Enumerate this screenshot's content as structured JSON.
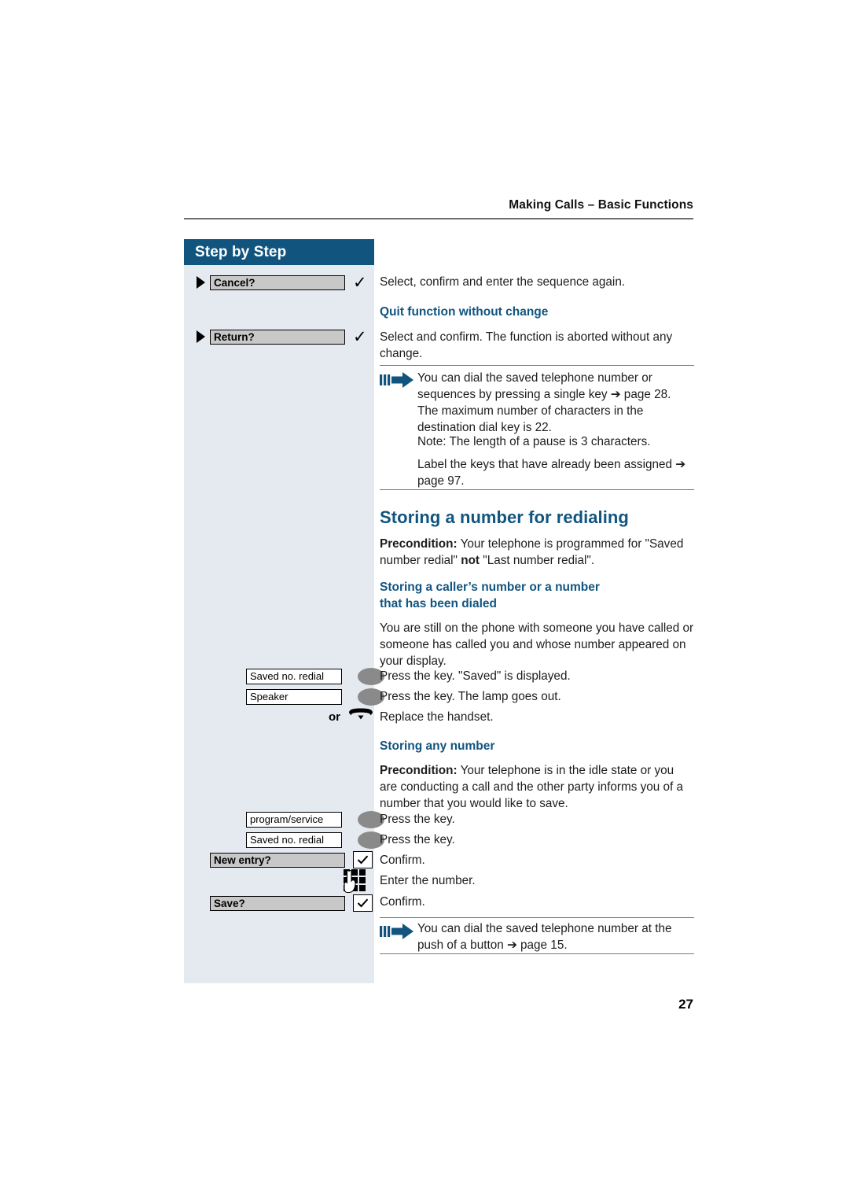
{
  "header": {
    "running_title": "Making Calls – Basic Functions"
  },
  "sidebar": {
    "title": "Step by Step",
    "bg_color": "#e5eaf1",
    "header_color": "#11557f",
    "softkeys": [
      {
        "label": "Cancel?",
        "icon": "triangle-bullet",
        "confirm": "check-icon"
      },
      {
        "label": "Return?",
        "icon": "triangle-bullet",
        "confirm": "check-icon"
      }
    ],
    "keys_group_1": [
      {
        "label": "Saved no. redial",
        "lamp": "on"
      },
      {
        "label": "Speaker",
        "lamp": "off"
      }
    ],
    "or_label": "or",
    "handset_icon": "handset-on-hook-icon",
    "keys_group_2": [
      {
        "label": "program/service",
        "lamp": "on"
      },
      {
        "label": "Saved no. redial",
        "lamp": "on"
      }
    ],
    "dialog_keys": [
      {
        "label": "New entry?",
        "confirm": "boxed-check-icon"
      },
      {
        "label": "Save?",
        "confirm": "boxed-check-icon"
      }
    ],
    "keypad_icon": "keypad-hand-icon"
  },
  "main": {
    "line_select_confirm": "Select, confirm and enter the sequence again.",
    "h3_quit": "Quit function without change",
    "p_quit": "Select and confirm. The function is aborted without any change.",
    "note1": {
      "icon": "note-arrow-icon",
      "para1": "You can dial the saved telephone number or sequences by pressing a single key ➔ page 28. The maximum number of characters in the destination dial key is 22.",
      "para2": "Note: The length of a pause is 3 characters.",
      "para3": "Label the keys that have already been assigned ➔ page 97."
    },
    "h2_storing_redial": "Storing a number for redialing",
    "precondition_label_1": "Precondition:",
    "precondition_text_1a": " Your telephone is programmed for \"Saved number redial\" ",
    "precondition_not": "not",
    "precondition_text_1b": " \"Last number redial\".",
    "h3_storing_caller_line1": "Storing a caller’s number or a number",
    "h3_storing_caller_line2": "that has been dialed",
    "p_still_on_phone": "You are still on the phone with someone you have called or someone has called you and whose number appeared on your display.",
    "step_press_key_saved": "Press the key. \"Saved\" is displayed.",
    "step_press_key_lamp": "Press the key. The lamp goes out.",
    "step_replace_handset": "Replace the handset.",
    "h3_storing_any": "Storing any number",
    "precondition_label_2": "Precondition:",
    "precondition_text_2": " Your telephone is in the idle state or you are conducting a call and the other party informs you of a number that you would like to save.",
    "step_press_key_1": "Press the key.",
    "step_press_key_2": "Press the key.",
    "step_confirm_1": "Confirm.",
    "step_enter_number": "Enter the number.",
    "step_confirm_2": "Confirm.",
    "note2": {
      "icon": "note-arrow-icon",
      "text": "You can dial the saved telephone number at the push of a button ➔ page 15."
    }
  },
  "footer": {
    "page_number": "27"
  },
  "colors": {
    "accent_blue": "#11557f",
    "sidebar_bg": "#e5eaf1",
    "softkey_grey": "#c8c8c8",
    "lamp_grey": "#8a8a8a"
  }
}
